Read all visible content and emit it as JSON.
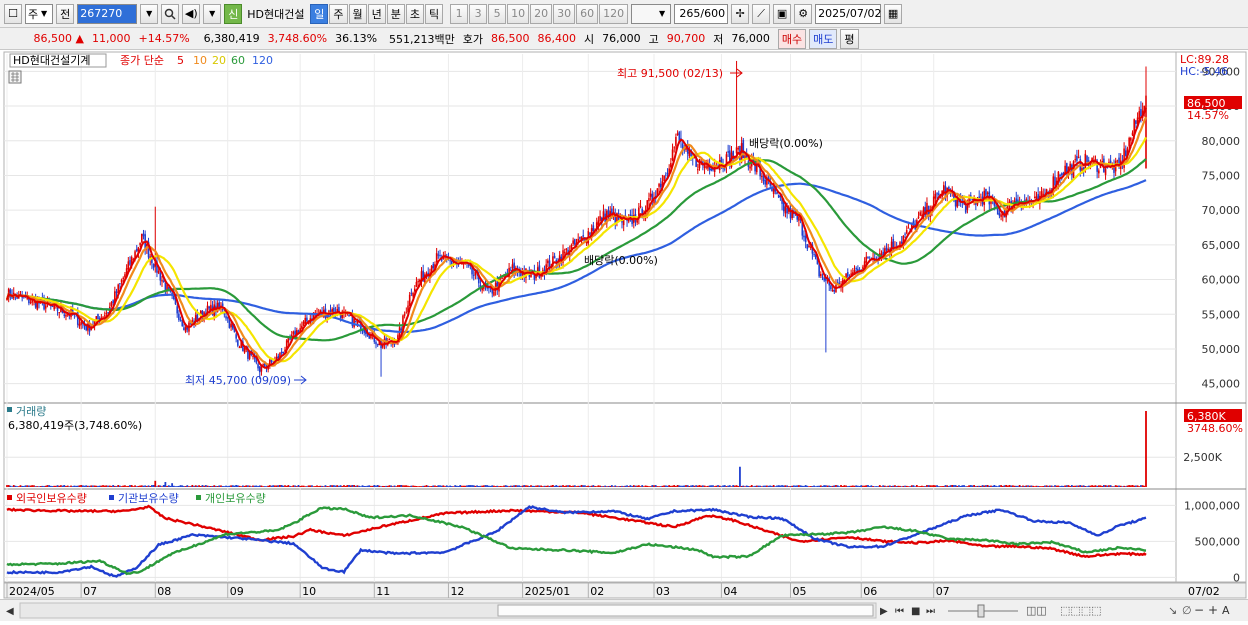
{
  "toolbar": {
    "type_select": "주",
    "jeon_btn": "전",
    "code_input": "267270",
    "sin_badge": "신",
    "stock_name": "HD현대건설",
    "periods": [
      "일",
      "주",
      "월",
      "년",
      "분",
      "초",
      "틱"
    ],
    "active_period": "일",
    "intervals": [
      "1",
      "3",
      "5",
      "10",
      "20",
      "30",
      "60",
      "120"
    ],
    "count_display": "265",
    "count_max": "/600",
    "date_input": "2025/07/02"
  },
  "quote": {
    "price": "86,500",
    "change_arrow": "▲",
    "change": "11,000",
    "change_pct": "+14.57%",
    "volume": "6,380,419",
    "volume_ratio": "3,748.60%",
    "turnover": "36.13%",
    "amount": "551,213백만",
    "ask_label": "호가",
    "ask1": "86,500",
    "ask2": "86,400",
    "open_label": "시",
    "open": "76,000",
    "high_label": "고",
    "high": "90,700",
    "low_label": "저",
    "low": "76,000",
    "buy_btn": "매수",
    "sell_btn": "매도",
    "eval_btn": "평"
  },
  "legend": {
    "stock": "HD현대건설기계",
    "ma_label": "종가 단순",
    "ma_periods": [
      "5",
      "10",
      "20",
      "60",
      "120"
    ]
  },
  "annotations": {
    "high_note": "최고 91,500 (02/13)",
    "low_note": "최저 45,700 (09/09)",
    "dividend_1": "배당락(0.00%)",
    "dividend_2": "배당락(0.00%)",
    "lc": "LC:89.28",
    "hc": "HC:-5.46",
    "last_price_badge": "86,500",
    "last_pct": "14.57%",
    "vol_title": "거래량",
    "vol_value": "6,380,419주(3,748.60%)",
    "vol_badge": "6,380K",
    "vol_pct": "3748.60%",
    "holder_labels": [
      "외국인보유수량",
      "기관보유수량",
      "개인보유수량"
    ],
    "x_end_date": "07/02"
  },
  "chart_data": [
    {
      "type": "candlestick",
      "title": "HD현대건설기계",
      "y_ticks": [
        45000,
        50000,
        55000,
        60000,
        65000,
        70000,
        75000,
        80000,
        85000,
        90000
      ],
      "y_tick_labels": [
        "45,000",
        "50,000",
        "55,000",
        "60,000",
        "65,000",
        "70,000",
        "75,000",
        "80,000",
        "85,000",
        "90,000"
      ],
      "ylim": [
        42500,
        92500
      ],
      "x_labels": [
        "2024/05",
        "07",
        "08",
        "09",
        "10",
        "11",
        "12",
        "2025/01",
        "02",
        "03",
        "04",
        "05",
        "06",
        "07"
      ],
      "close_keypoints": [
        [
          0,
          58000
        ],
        [
          20,
          56500
        ],
        [
          38,
          55000
        ],
        [
          48,
          53000
        ],
        [
          60,
          55500
        ],
        [
          80,
          66000
        ],
        [
          88,
          62000
        ],
        [
          96,
          58000
        ],
        [
          106,
          53000
        ],
        [
          118,
          55500
        ],
        [
          128,
          56000
        ],
        [
          136,
          51500
        ],
        [
          150,
          47000
        ],
        [
          160,
          48500
        ],
        [
          172,
          52500
        ],
        [
          182,
          55000
        ],
        [
          196,
          55500
        ],
        [
          212,
          53000
        ],
        [
          222,
          50500
        ],
        [
          232,
          51500
        ],
        [
          240,
          58500
        ],
        [
          255,
          63000
        ],
        [
          272,
          62000
        ],
        [
          286,
          58000
        ],
        [
          300,
          61500
        ],
        [
          312,
          60500
        ],
        [
          324,
          62500
        ],
        [
          340,
          65500
        ],
        [
          356,
          69500
        ],
        [
          368,
          68000
        ],
        [
          380,
          70500
        ],
        [
          390,
          75000
        ],
        [
          398,
          80500
        ],
        [
          404,
          77500
        ],
        [
          414,
          76500
        ],
        [
          425,
          77000
        ],
        [
          436,
          78500
        ],
        [
          448,
          75000
        ],
        [
          460,
          70500
        ],
        [
          470,
          68500
        ],
        [
          482,
          61000
        ],
        [
          490,
          58500
        ],
        [
          500,
          60500
        ],
        [
          512,
          63000
        ],
        [
          530,
          65500
        ],
        [
          546,
          70000
        ],
        [
          556,
          73000
        ],
        [
          568,
          70500
        ],
        [
          580,
          72000
        ],
        [
          590,
          69500
        ],
        [
          600,
          71500
        ],
        [
          612,
          71000
        ],
        [
          625,
          75500
        ],
        [
          640,
          77000
        ],
        [
          660,
          76000
        ],
        [
          676,
          86500
        ]
      ],
      "series": [
        {
          "name": "5",
          "values": "moving average of close"
        },
        {
          "name": "10",
          "values": "moving average of close"
        },
        {
          "name": "20",
          "values": "moving average of close"
        },
        {
          "name": "60",
          "values": "moving average of close"
        },
        {
          "name": "120",
          "values": "moving average of close"
        }
      ],
      "last": {
        "open": 76000,
        "high": 90700,
        "low": 76000,
        "close": 86500
      },
      "all_time_high": 91500,
      "all_time_low": 45700,
      "colors": {
        "up": "#e00000",
        "down": "#1f3fd0",
        "ma5": "#e00000",
        "ma10": "#f08a1c",
        "ma20": "#f5e500",
        "ma60": "#2a9a3a",
        "ma120": "#2f5fe0"
      }
    },
    {
      "type": "bar",
      "title": "거래량",
      "y_ticks": [
        2500000
      ],
      "y_tick_labels": [
        "2,500K"
      ],
      "ylim": [
        0,
        6800000
      ],
      "last_value": 6380419,
      "spikes": [
        [
          88,
          520000
        ],
        [
          94,
          420000
        ],
        [
          98,
          320000
        ],
        [
          435,
          1700000
        ],
        [
          676,
          6380419
        ]
      ]
    },
    {
      "type": "line",
      "title": "보유수량",
      "y_ticks": [
        0,
        500000,
        1000000
      ],
      "y_tick_labels": [
        "0",
        "500,000",
        "1,000,000"
      ],
      "ylim": [
        -50000,
        1130000
      ],
      "series": [
        {
          "name": "외국인보유수량",
          "color": "#e00000",
          "keypoints": [
            [
              0,
              940000
            ],
            [
              40,
              920000
            ],
            [
              70,
              920000
            ],
            [
              84,
              980000
            ],
            [
              94,
              820000
            ],
            [
              110,
              740000
            ],
            [
              130,
              630000
            ],
            [
              150,
              520000
            ],
            [
              170,
              570000
            ],
            [
              180,
              660000
            ],
            [
              200,
              580000
            ],
            [
              225,
              720000
            ],
            [
              260,
              890000
            ],
            [
              300,
              930000
            ],
            [
              340,
              900000
            ],
            [
              380,
              760000
            ],
            [
              396,
              700000
            ],
            [
              416,
              860000
            ],
            [
              430,
              800000
            ],
            [
              470,
              500000
            ],
            [
              500,
              560000
            ],
            [
              520,
              500000
            ],
            [
              540,
              480000
            ],
            [
              560,
              510000
            ],
            [
              580,
              430000
            ],
            [
              600,
              430000
            ],
            [
              620,
              400000
            ],
            [
              640,
              290000
            ],
            [
              660,
              330000
            ],
            [
              676,
              320000
            ]
          ]
        },
        {
          "name": "기관보유수량",
          "color": "#1f3fd0",
          "keypoints": [
            [
              0,
              70000
            ],
            [
              30,
              70000
            ],
            [
              50,
              150000
            ],
            [
              64,
              10000
            ],
            [
              76,
              120000
            ],
            [
              90,
              450000
            ],
            [
              110,
              590000
            ],
            [
              140,
              540000
            ],
            [
              170,
              470000
            ],
            [
              188,
              120000
            ],
            [
              200,
              80000
            ],
            [
              210,
              380000
            ],
            [
              230,
              330000
            ],
            [
              260,
              350000
            ],
            [
              290,
              630000
            ],
            [
              310,
              980000
            ],
            [
              330,
              900000
            ],
            [
              360,
              920000
            ],
            [
              380,
              810000
            ],
            [
              396,
              920000
            ],
            [
              420,
              940000
            ],
            [
              440,
              840000
            ],
            [
              460,
              820000
            ],
            [
              480,
              530000
            ],
            [
              500,
              420000
            ],
            [
              520,
              430000
            ],
            [
              540,
              600000
            ],
            [
              570,
              860000
            ],
            [
              590,
              940000
            ],
            [
              610,
              780000
            ],
            [
              630,
              760000
            ],
            [
              648,
              580000
            ],
            [
              660,
              720000
            ],
            [
              676,
              820000
            ]
          ]
        },
        {
          "name": "개인보유수량",
          "color": "#2a9a3a",
          "keypoints": [
            [
              0,
              180000
            ],
            [
              30,
              190000
            ],
            [
              55,
              230000
            ],
            [
              72,
              50000
            ],
            [
              80,
              90000
            ],
            [
              96,
              310000
            ],
            [
              130,
              600000
            ],
            [
              160,
              650000
            ],
            [
              170,
              750000
            ],
            [
              186,
              960000
            ],
            [
              200,
              950000
            ],
            [
              215,
              830000
            ],
            [
              240,
              860000
            ],
            [
              270,
              700000
            ],
            [
              300,
              400000
            ],
            [
              330,
              380000
            ],
            [
              360,
              340000
            ],
            [
              380,
              460000
            ],
            [
              396,
              420000
            ],
            [
              410,
              380000
            ],
            [
              420,
              280000
            ],
            [
              440,
              290000
            ],
            [
              460,
              580000
            ],
            [
              480,
              600000
            ],
            [
              500,
              620000
            ],
            [
              520,
              700000
            ],
            [
              540,
              640000
            ],
            [
              560,
              530000
            ],
            [
              580,
              520000
            ],
            [
              600,
              460000
            ],
            [
              620,
              490000
            ],
            [
              640,
              350000
            ],
            [
              660,
              410000
            ],
            [
              676,
              380000
            ]
          ]
        }
      ]
    }
  ]
}
